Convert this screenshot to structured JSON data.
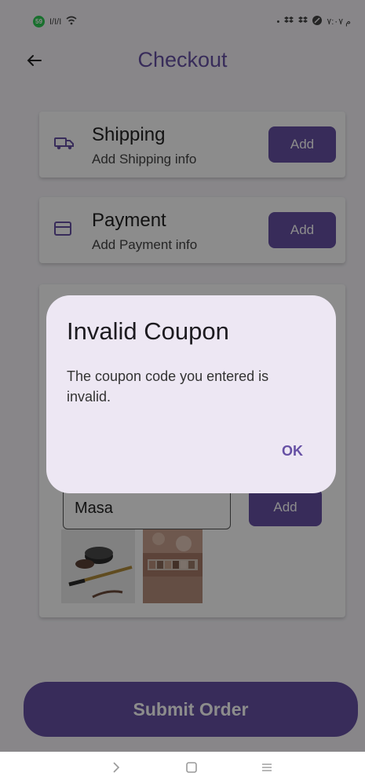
{
  "status_bar": {
    "battery_badge": "59",
    "network_text": "I/I/I",
    "time_text": "م ٧:٠٧"
  },
  "app_bar": {
    "title": "Checkout",
    "back_icon": "arrow-left-icon"
  },
  "shipping_card": {
    "title": "Shipping",
    "subtitle": "Add Shipping info",
    "button_label": "Add",
    "icon": "truck-icon"
  },
  "payment_card": {
    "title": "Payment",
    "subtitle": "Add Payment info",
    "button_label": "Add",
    "icon": "credit-card-icon"
  },
  "products_card": {
    "coupon_value": "Masa",
    "coupon_button_label": "Add",
    "thumbnails": [
      "eyebrow-pomade-product",
      "eyeshadow-palette-product"
    ]
  },
  "submit": {
    "label": "Submit Order"
  },
  "dialog": {
    "title": "Invalid Coupon",
    "message": "The coupon code you entered is invalid.",
    "ok_label": "OK"
  },
  "system_nav": {
    "icons": [
      "back-chevron-icon",
      "home-square-icon",
      "menu-lines-icon"
    ]
  },
  "colors": {
    "primary": "#6650a4",
    "dialog_bg": "#ede7f3",
    "screen_bg": "#f7f5fa"
  }
}
